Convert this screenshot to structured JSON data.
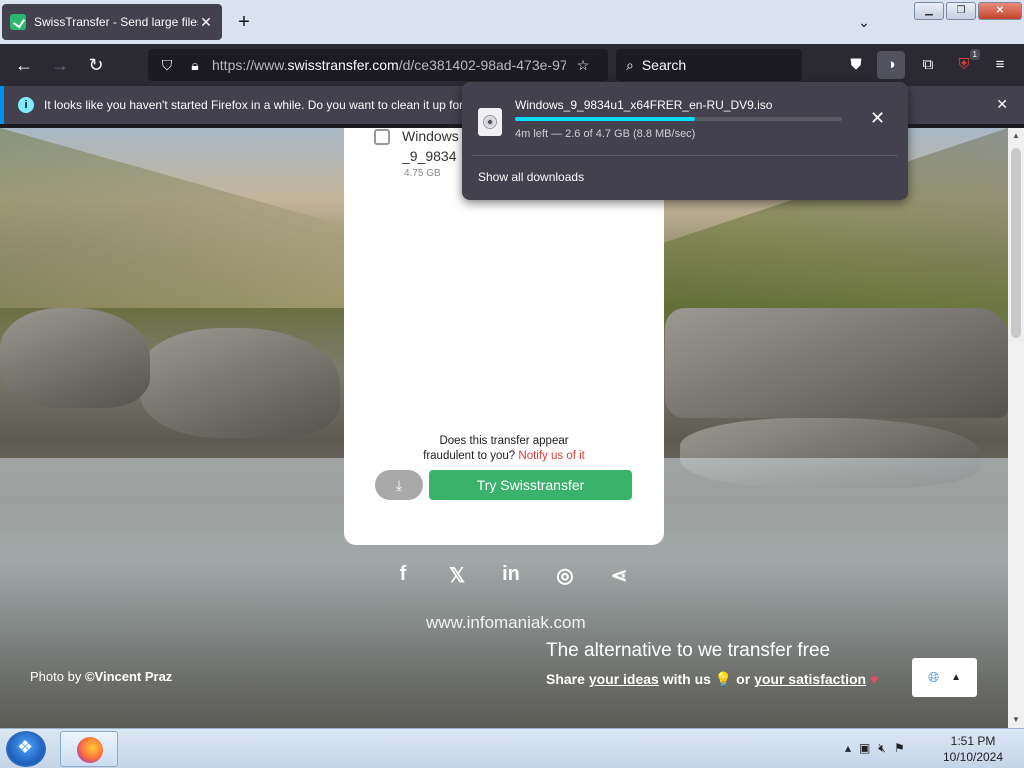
{
  "browser": {
    "tab_title": "SwissTransfer - Send large files",
    "tab_close": "✕",
    "newtab": "+",
    "tablist": "⌄",
    "url_prefix": "https://www.",
    "url_domain": "swisstransfer.com",
    "url_path": "/d/ce381402-98ad-473e-97",
    "search_placeholder": "Search",
    "extension_badge": "1"
  },
  "notification": {
    "text": "It looks like you haven't started Firefox in a while. Do you want to clean it up for",
    "close": "✕"
  },
  "downloads": {
    "filename": "Windows_9_9834u1_x64FRER_en-RU_DV9.iso",
    "status": "4m left — 2.6 of 4.7 GB (8.8 MB/sec)",
    "progress": 0.55,
    "show_all": "Show all downloads",
    "close": "✕"
  },
  "page": {
    "file_name": "Windows_9_9834u1_x64FRER_en-RU_DV9.iso",
    "file_name_visible": "Windows_en-RU_I",
    "file_size": "4.75 GB",
    "fraud_line1": "Does this transfer appear",
    "fraud_line2": "fraudulent to you?",
    "fraud_link": "Notify us of it",
    "download_icon": "⤓",
    "try_button": "Try Swisstransfer",
    "website": "www.infomaniak.com",
    "photo_prefix": "Photo by ",
    "photo_author": "©Vincent Praz",
    "alt_title": "The alternative to we transfer free",
    "share_1": "Share ",
    "share_ideas": "your ideas",
    "share_2": " with us ",
    "share_3": " or ",
    "share_satisfaction": "your satisfaction",
    "social": [
      "f",
      "𝕏",
      "in",
      "◎",
      "⋖"
    ]
  },
  "taskbar": {
    "time": "1:51 PM",
    "date": "10/10/2024"
  },
  "colors": {
    "accent": "#00ddff",
    "try_green": "#3bb26b",
    "fraud_red": "#e03c3c"
  }
}
